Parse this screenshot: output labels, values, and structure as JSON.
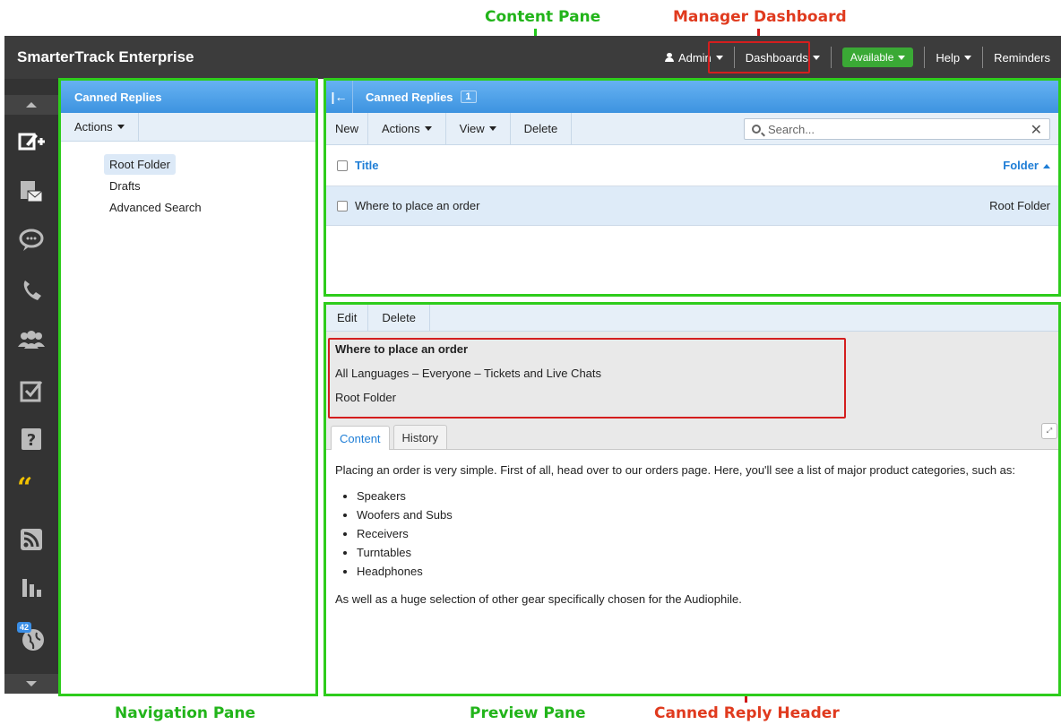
{
  "annotations": {
    "content_pane": "Content Pane",
    "manager_dashboard": "Manager Dashboard",
    "navigation_pane": "Navigation Pane",
    "preview_pane": "Preview Pane",
    "canned_reply_header": "Canned Reply Header"
  },
  "topbar": {
    "brand": "SmarterTrack Enterprise",
    "user": "Admin",
    "dashboards": "Dashboards",
    "status": "Available",
    "help": "Help",
    "reminders": "Reminders"
  },
  "rail": {
    "icons": [
      "new-item-icon",
      "tickets-icon",
      "live-chat-icon",
      "calls-icon",
      "users-icon",
      "tasks-icon",
      "knowledge-base-icon",
      "canned-replies-icon",
      "rss-icon",
      "reports-icon",
      "whos-on-icon"
    ],
    "whos_on_badge": "42"
  },
  "nav": {
    "title": "Canned Replies",
    "actions": "Actions",
    "folders": [
      "Root Folder",
      "Drafts",
      "Advanced Search"
    ]
  },
  "content": {
    "title": "Canned Replies",
    "count": "1",
    "toolbar": {
      "new": "New",
      "actions": "Actions",
      "view": "View",
      "delete": "Delete"
    },
    "search_placeholder": "Search...",
    "columns": {
      "title": "Title",
      "folder": "Folder"
    },
    "rows": [
      {
        "title": "Where to place an order",
        "folder": "Root Folder"
      }
    ]
  },
  "preview": {
    "toolbar": {
      "edit": "Edit",
      "delete": "Delete"
    },
    "header": {
      "title": "Where to place an order",
      "meta": "All Languages – Everyone – Tickets and Live Chats",
      "folder": "Root Folder"
    },
    "tabs": {
      "content": "Content",
      "history": "History"
    },
    "body": {
      "intro": "Placing an order is very simple. First of all, head over to our orders page. Here, you'll see a list of major product categories, such as:",
      "items": [
        "Speakers",
        "Woofers and Subs",
        "Receivers",
        "Turntables",
        "Headphones"
      ],
      "outro": "As well as a huge selection of other gear specifically chosen for the Audiophile."
    }
  }
}
